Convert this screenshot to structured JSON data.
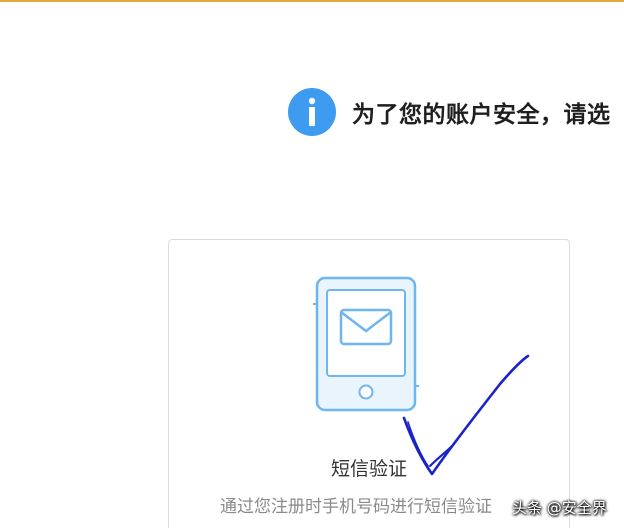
{
  "notice": {
    "icon": "info-icon",
    "text": "为了您的账户安全，请选"
  },
  "verify_option": {
    "icon": "phone-sms-icon",
    "title": "短信验证",
    "description": "通过您注册时手机号码进行短信验证"
  },
  "annotation": {
    "type": "hand-drawn-checkmark",
    "color": "#1a23c8"
  },
  "watermark": {
    "text": "头条 @安全界"
  },
  "colors": {
    "accent": "#3d9cf0",
    "top_rule": "#e0ab3a"
  }
}
